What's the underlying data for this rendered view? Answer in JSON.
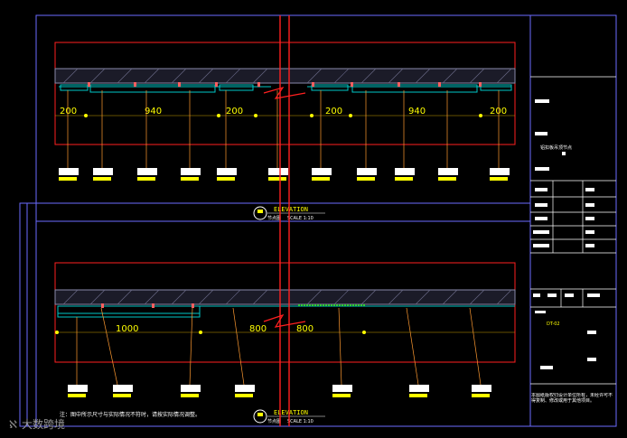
{
  "colors": {
    "background": "#000000",
    "frame": "#6b6bff",
    "boundary": "#ff2020",
    "dimension": "#ffff00",
    "leader": "#ff9a30",
    "hatch": "#8a8aaa",
    "ceiling": "#00c8c8",
    "title_block": "#ffffff"
  },
  "top_elevation": {
    "dimensions": [
      "200",
      "940",
      "200",
      "200",
      "940",
      "200"
    ],
    "callout_tags": [
      "",
      "",
      "",
      "",
      "",
      "",
      "",
      "",
      "",
      "",
      ""
    ],
    "title": "ELEVATION",
    "subtitle": "节点图",
    "scale": "SCALE 1:10"
  },
  "bottom_elevation": {
    "dimensions": [
      "1000",
      "800",
      "800"
    ],
    "callout_tags": [
      "",
      "",
      "",
      "",
      "",
      "",
      "",
      ""
    ],
    "title": "ELEVATION",
    "subtitle": "节点图",
    "scale": "SCALE 1:10",
    "note": "注：图中所示尺寸与实际情况不符时，请按实际情况调整。"
  },
  "title_block": {
    "project_name": "铝扣板吊顶节点",
    "drawing_no": "DT-02",
    "notice": "本图纸版权归设计单位所有，未经许可不得复制、修改或用于其他项目。"
  },
  "watermark": "大数跨境"
}
